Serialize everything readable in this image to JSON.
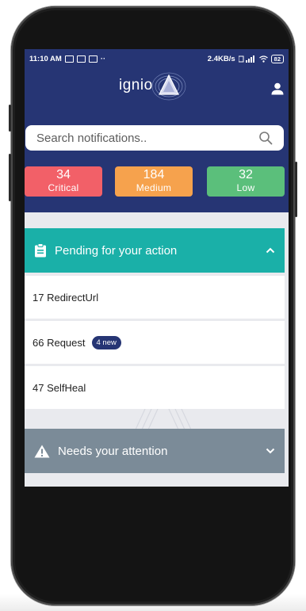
{
  "status_bar": {
    "time": "11:10 AM",
    "dots": "··",
    "network_speed": "2.4KB/s",
    "battery": "82"
  },
  "header": {
    "logo_text": "ignio"
  },
  "search": {
    "placeholder": "Search notifications.."
  },
  "counts": [
    {
      "value": "34",
      "label": "Critical",
      "color": "#f26068"
    },
    {
      "value": "184",
      "label": "Medium",
      "color": "#f6a24d"
    },
    {
      "value": "32",
      "label": "Low",
      "color": "#5bbf7b"
    }
  ],
  "pending": {
    "title": "Pending for your action",
    "items": [
      {
        "label": "17 RedirectUrl"
      },
      {
        "label": "66 Request",
        "badge": "4 new"
      },
      {
        "label": "47 SelfHeal"
      }
    ]
  },
  "attention": {
    "title": "Needs your attention"
  },
  "colors": {
    "primary": "#263574",
    "teal": "#1ab0a8",
    "grey_section": "#7b8b98"
  }
}
